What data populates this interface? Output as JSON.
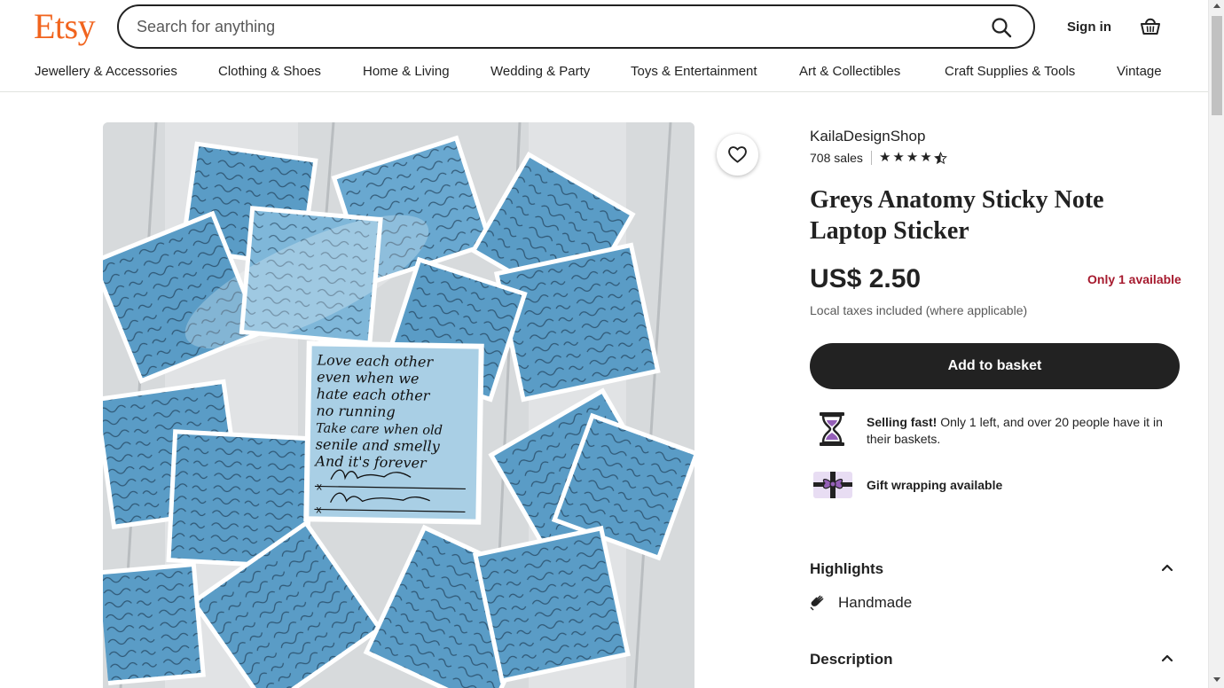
{
  "header": {
    "logo": "Etsy",
    "search_placeholder": "Search for anything",
    "sign_in": "Sign in"
  },
  "nav": {
    "items": [
      "Jewellery & Accessories",
      "Clothing & Shoes",
      "Home & Living",
      "Wedding & Party",
      "Toys & Entertainment",
      "Art & Collectibles",
      "Craft Supplies & Tools",
      "Vintage"
    ]
  },
  "listing": {
    "shop_name": "KailaDesignShop",
    "sales": "708 sales",
    "rating": 4.5,
    "title": "Greys Anatomy Sticky Note Laptop Sticker",
    "price": "US$ 2.50",
    "stock": "Only 1 available",
    "taxes": "Local taxes included (where applicable)",
    "add_to_basket": "Add to basket",
    "selling_fast_lead": "Selling fast!",
    "selling_fast_text": " Only 1 left, and over 20 people have it in their baskets.",
    "gift_wrapping": "Gift wrapping available",
    "highlights_label": "Highlights",
    "highlight_handmade": "Handmade",
    "description_label": "Description"
  },
  "image": {
    "note_lines": [
      "Love each other",
      "even when we",
      "hate each other",
      "no running",
      "Take care when old",
      "senile and smelly",
      "And it's forever"
    ]
  },
  "colors": {
    "brand": "#f1641e",
    "stock_red": "#a61a2e",
    "button_dark": "#222222",
    "sticker_blue": "#5a9cc6"
  }
}
